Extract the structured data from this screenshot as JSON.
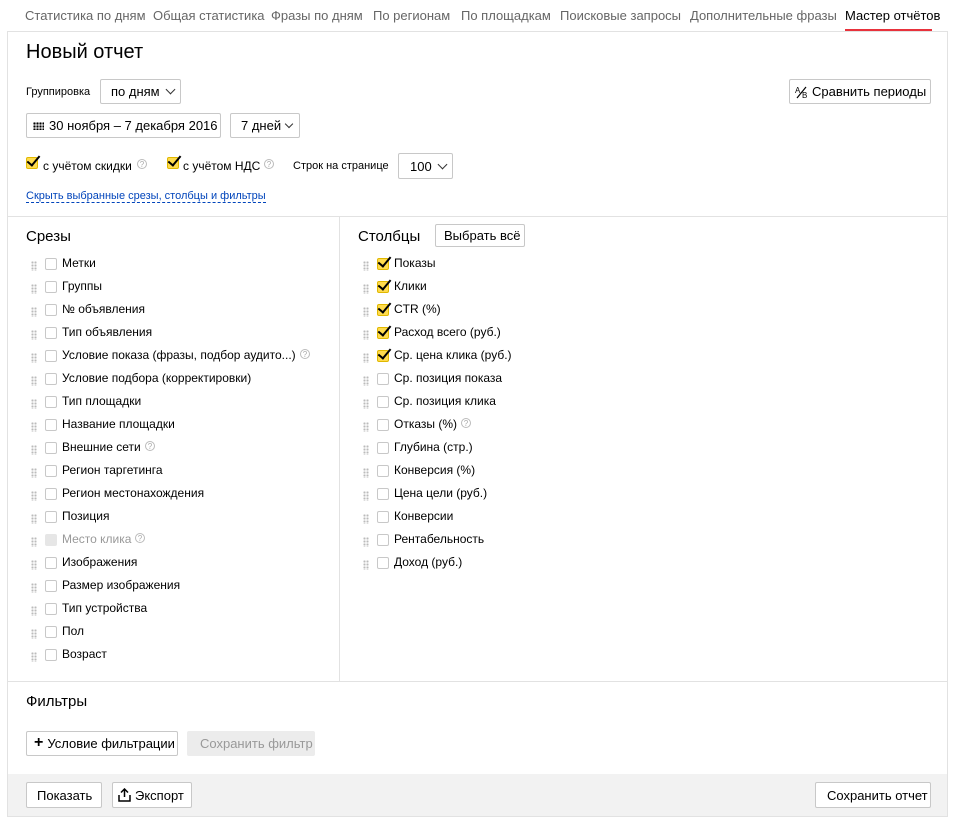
{
  "tabs": [
    {
      "label": "Статистика по дням"
    },
    {
      "label": "Общая статистика"
    },
    {
      "label": "Фразы по дням"
    },
    {
      "label": "По регионам"
    },
    {
      "label": "По площадкам"
    },
    {
      "label": "Поисковые запросы"
    },
    {
      "label": "Дополнительные фразы"
    },
    {
      "label": "Мастер отчётов",
      "active": true
    }
  ],
  "page_title": "Новый отчет",
  "grouping": {
    "label": "Группировка",
    "value": "по дням"
  },
  "compare_button": "Сравнить периоды",
  "date_range": "30 ноября – 7 декабря 2016",
  "period": "7 дней",
  "options": {
    "discount_label": "с учётом скидки",
    "discount_checked": true,
    "vat_label": "с учётом НДС",
    "vat_checked": true,
    "rows_label": "Строк на странице",
    "rows_value": "100"
  },
  "toggle_link": "Скрыть выбранные срезы, столбцы и фильтры",
  "slices": {
    "title": "Срезы",
    "items": [
      {
        "label": "Метки",
        "checked": false
      },
      {
        "label": "Группы",
        "checked": false
      },
      {
        "label": "№ объявления",
        "checked": false
      },
      {
        "label": "Тип объявления",
        "checked": false
      },
      {
        "label": "Условие показа (фразы, подбор аудито...)",
        "checked": false,
        "help": true
      },
      {
        "label": "Условие подбора (корректировки)",
        "checked": false
      },
      {
        "label": "Тип площадки",
        "checked": false
      },
      {
        "label": "Название площадки",
        "checked": false
      },
      {
        "label": "Внешние сети",
        "checked": false,
        "help": true
      },
      {
        "label": "Регион таргетинга",
        "checked": false
      },
      {
        "label": "Регион местонахождения",
        "checked": false
      },
      {
        "label": "Позиция",
        "checked": false
      },
      {
        "label": "Место клика",
        "checked": false,
        "disabled": true,
        "help": true
      },
      {
        "label": "Изображения",
        "checked": false
      },
      {
        "label": "Размер изображения",
        "checked": false
      },
      {
        "label": "Тип устройства",
        "checked": false
      },
      {
        "label": "Пол",
        "checked": false
      },
      {
        "label": "Возраст",
        "checked": false
      }
    ]
  },
  "columns": {
    "title": "Столбцы",
    "select_all": "Выбрать всё",
    "items": [
      {
        "label": "Показы",
        "checked": true
      },
      {
        "label": "Клики",
        "checked": true
      },
      {
        "label": "CTR (%)",
        "checked": true
      },
      {
        "label": "Расход всего (руб.)",
        "checked": true
      },
      {
        "label": "Ср. цена клика (руб.)",
        "checked": true
      },
      {
        "label": "Ср. позиция показа",
        "checked": false
      },
      {
        "label": "Ср. позиция клика",
        "checked": false
      },
      {
        "label": "Отказы (%)",
        "checked": false,
        "help": true
      },
      {
        "label": "Глубина (стр.)",
        "checked": false
      },
      {
        "label": "Конверсия (%)",
        "checked": false
      },
      {
        "label": "Цена цели (руб.)",
        "checked": false
      },
      {
        "label": "Конверсии",
        "checked": false
      },
      {
        "label": "Рентабельность",
        "checked": false
      },
      {
        "label": "Доход (руб.)",
        "checked": false
      }
    ]
  },
  "filters": {
    "title": "Фильтры",
    "add_condition": "Условие фильтрации",
    "save_filter": "Сохранить фильтр"
  },
  "footer": {
    "show": "Показать",
    "export": "Экспорт",
    "save_report": "Сохранить отчет"
  },
  "help_glyph": "?",
  "colors": {
    "accent_tab": "#e8323c",
    "checkbox_on": "#ffdb4d",
    "link": "#0044bb"
  }
}
